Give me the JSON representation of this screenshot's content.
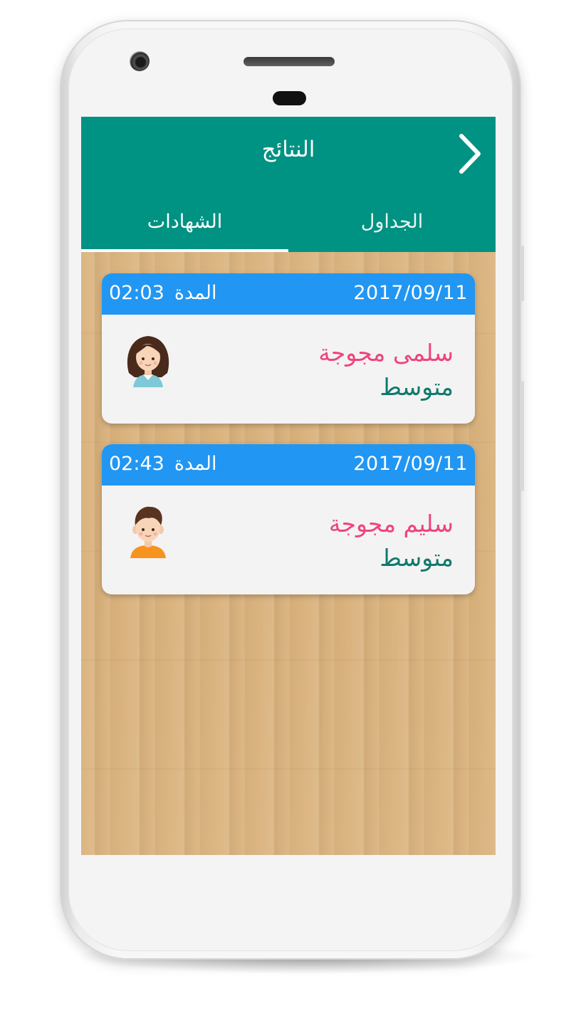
{
  "app": {
    "title": "النتائج",
    "back_icon": "chevron-right-icon",
    "tabs": [
      {
        "label": "الشهادات",
        "selected": true
      },
      {
        "label": "الجداول",
        "selected": false
      }
    ]
  },
  "results": [
    {
      "date": "2017/09/11",
      "duration_label": "المدة",
      "duration": "02:03",
      "name": "سلمى مجوجة",
      "level": "متوسط",
      "avatar": "girl-avatar-icon"
    },
    {
      "date": "2017/09/11",
      "duration_label": "المدة",
      "duration": "02:43",
      "name": "سليم مجوجة",
      "level": "متوسط",
      "avatar": "boy-avatar-icon"
    }
  ],
  "colors": {
    "appbar": "#009282",
    "card_header": "#2196f3",
    "name": "#f0447c",
    "level": "#0f7a6b"
  }
}
